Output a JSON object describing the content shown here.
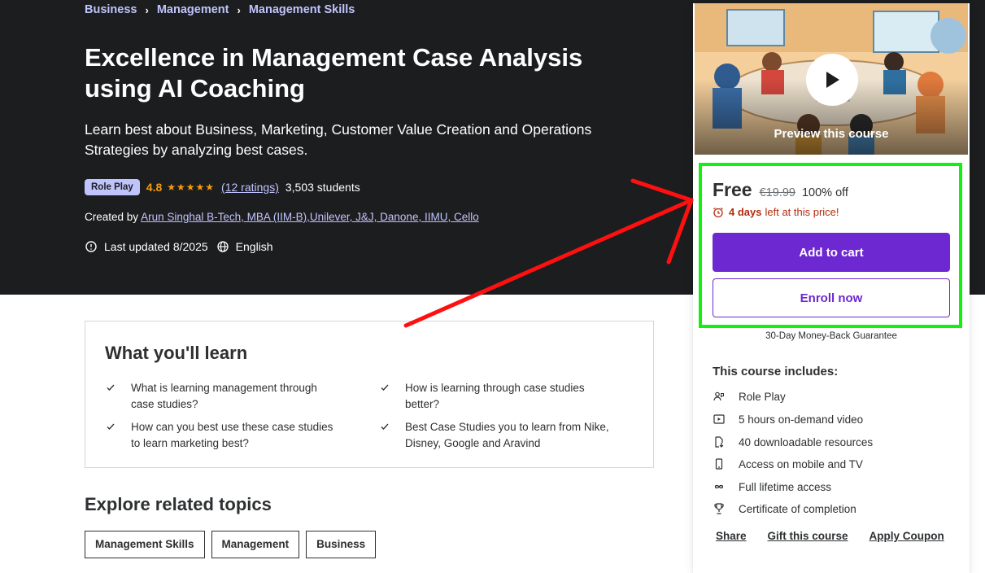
{
  "breadcrumb": [
    "Business",
    "Management",
    "Management Skills"
  ],
  "course": {
    "title": "Excellence in Management Case Analysis using AI Coaching",
    "subtitle": "Learn best about Business, Marketing, Customer Value Creation and Operations Strategies by analyzing best cases.",
    "badge": "Role Play",
    "rating": "4.8",
    "ratings_count": "(12 ratings)",
    "students": "3,503 students",
    "created_by_label": "Created by",
    "instructors": "Arun Singhal B-Tech, MBA (IIM-B),Unilever, J&J, Danone, IIMU, Cello",
    "last_updated": "Last updated 8/2025",
    "language": "English"
  },
  "learn": {
    "title": "What you'll learn",
    "items": [
      "What is learning management through case studies?",
      "How is learning through case studies better?",
      "How can you best use these case studies to learn marketing best?",
      "Best Case Studies you to learn from Nike, Disney, Google and Aravind"
    ]
  },
  "related": {
    "title": "Explore related topics",
    "topics": [
      "Management Skills",
      "Management",
      "Business"
    ]
  },
  "sidebar": {
    "preview_label": "Preview this course",
    "price": "Free",
    "original_price": "€19.99",
    "discount": "100% off",
    "timer_bold": "4 days",
    "timer_rest": "left at this price!",
    "add_to_cart": "Add to cart",
    "enroll_now": "Enroll now",
    "guarantee": "30-Day Money-Back Guarantee",
    "includes_title": "This course includes:",
    "includes": [
      {
        "icon": "role-play-icon",
        "label": "Role Play"
      },
      {
        "icon": "video-icon",
        "label": "5 hours on-demand video"
      },
      {
        "icon": "file-download-icon",
        "label": "40 downloadable resources"
      },
      {
        "icon": "mobile-icon",
        "label": "Access on mobile and TV"
      },
      {
        "icon": "infinity-icon",
        "label": "Full lifetime access"
      },
      {
        "icon": "trophy-icon",
        "label": "Certificate of completion"
      }
    ],
    "links": [
      "Share",
      "Gift this course",
      "Apply Coupon"
    ]
  },
  "colors": {
    "hero_bg": "#1c1d1f",
    "accent_purple": "#6d28d2",
    "link_lavender": "#c0c4fc",
    "star": "#f69c08",
    "timer_red": "#b32d0f",
    "annotation_green": "#12f012",
    "annotation_red": "#ff1010"
  }
}
